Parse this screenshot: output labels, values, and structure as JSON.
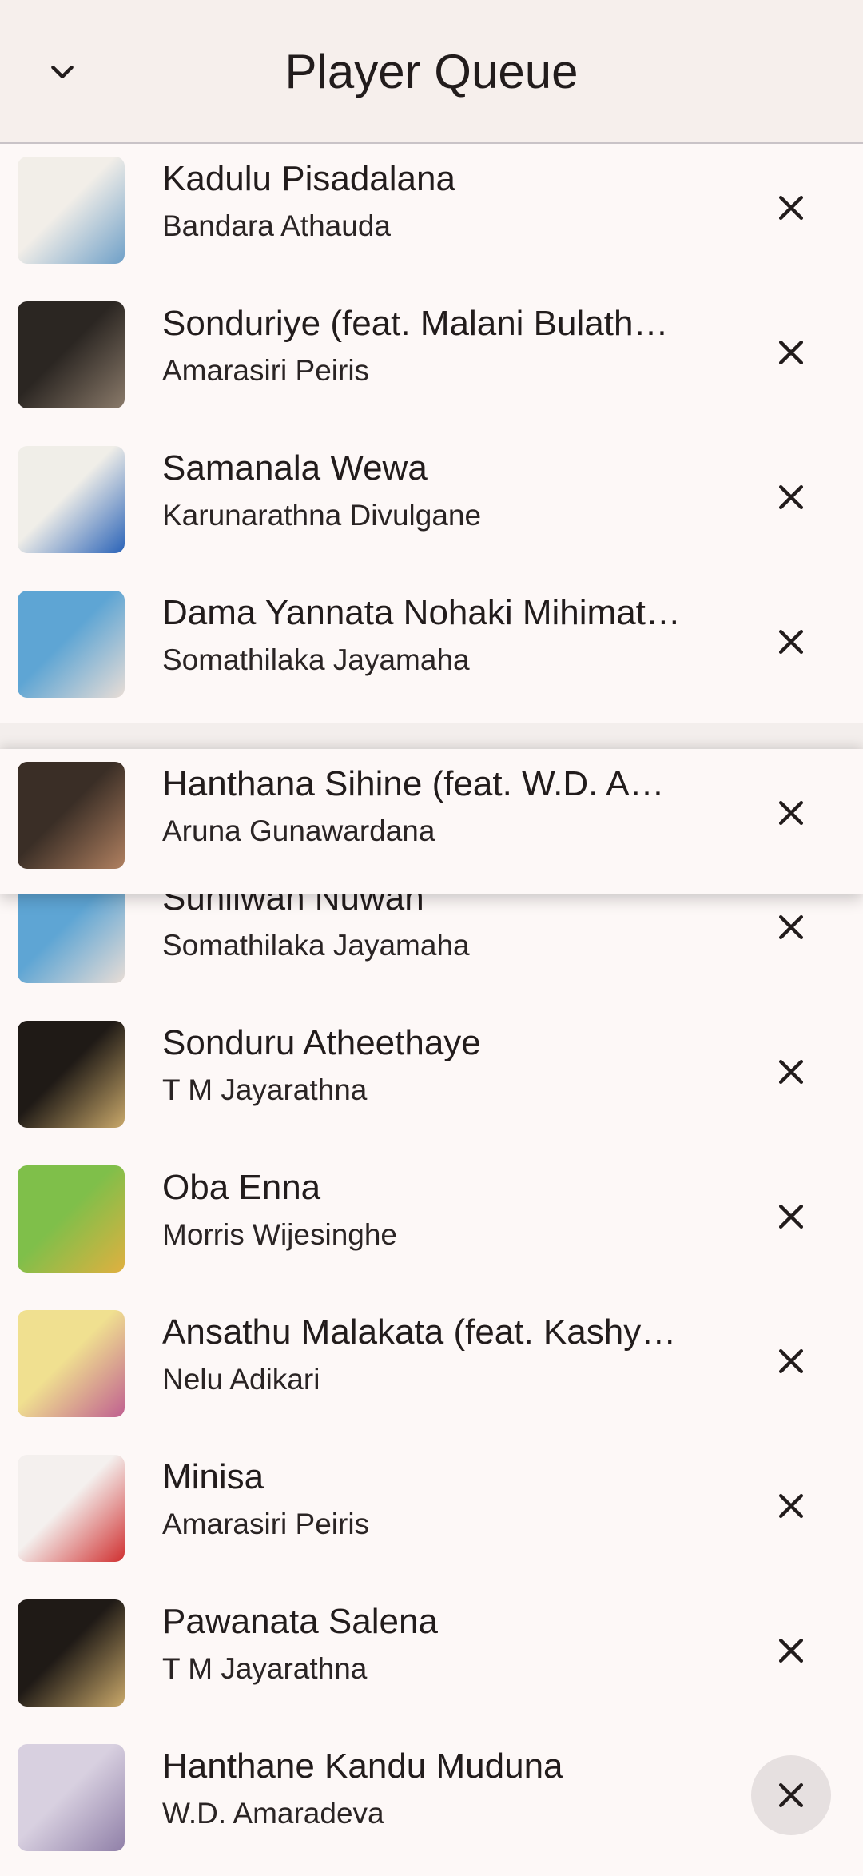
{
  "header": {
    "title": "Player Queue",
    "back_icon": "chevron-down-icon"
  },
  "queue": [
    {
      "title": "Kadulu Pisadalana",
      "artist": "Bandara Athauda",
      "art": [
        "#f2eee8",
        "#6fa0c8"
      ]
    },
    {
      "title": "Sonduriye (feat. Malani Bulath…",
      "artist": "Amarasiri Peiris",
      "art": [
        "#2b2622",
        "#8a7a6a"
      ]
    },
    {
      "title": "Samanala Wewa",
      "artist": "Karunarathna Divulgane",
      "art": [
        "#f0eee8",
        "#2a63b8"
      ]
    },
    {
      "title": "Dama Yannata Nohaki Mihimat…",
      "artist": "Somathilaka Jayamaha",
      "art": [
        "#5ea5d4",
        "#e8ddd6"
      ]
    },
    {
      "title": "Hanthana Sihine (feat. W.D. A…",
      "artist": "Aruna Gunawardana",
      "art": [
        "#3a2e26",
        "#b08060"
      ]
    },
    {
      "title": "Sunilwan Nuwan",
      "artist": "Somathilaka Jayamaha",
      "art": [
        "#5ea5d4",
        "#e8ddd6"
      ]
    },
    {
      "title": "Sonduru Atheethaye",
      "artist": "T M Jayarathna",
      "art": [
        "#1f1a16",
        "#c9a86a"
      ]
    },
    {
      "title": "Oba Enna",
      "artist": "Morris Wijesinghe",
      "art": [
        "#7fbf4a",
        "#e0b040"
      ]
    },
    {
      "title": "Ansathu Malakata (feat. Kashy…",
      "artist": "Nelu Adikari",
      "art": [
        "#f0e090",
        "#c06090"
      ]
    },
    {
      "title": "Minisa",
      "artist": "Amarasiri Peiris",
      "art": [
        "#f4f0ee",
        "#d03030"
      ]
    },
    {
      "title": "Pawanata Salena",
      "artist": "T M Jayarathna",
      "art": [
        "#1f1a16",
        "#c9a86a"
      ]
    },
    {
      "title": "Hanthane Kandu Muduna",
      "artist": "W.D. Amaradeva",
      "art": [
        "#d8d0e0",
        "#9080a8"
      ]
    }
  ],
  "remove_icon": "close-icon",
  "dragged_index": 4,
  "pressed_index": 11
}
